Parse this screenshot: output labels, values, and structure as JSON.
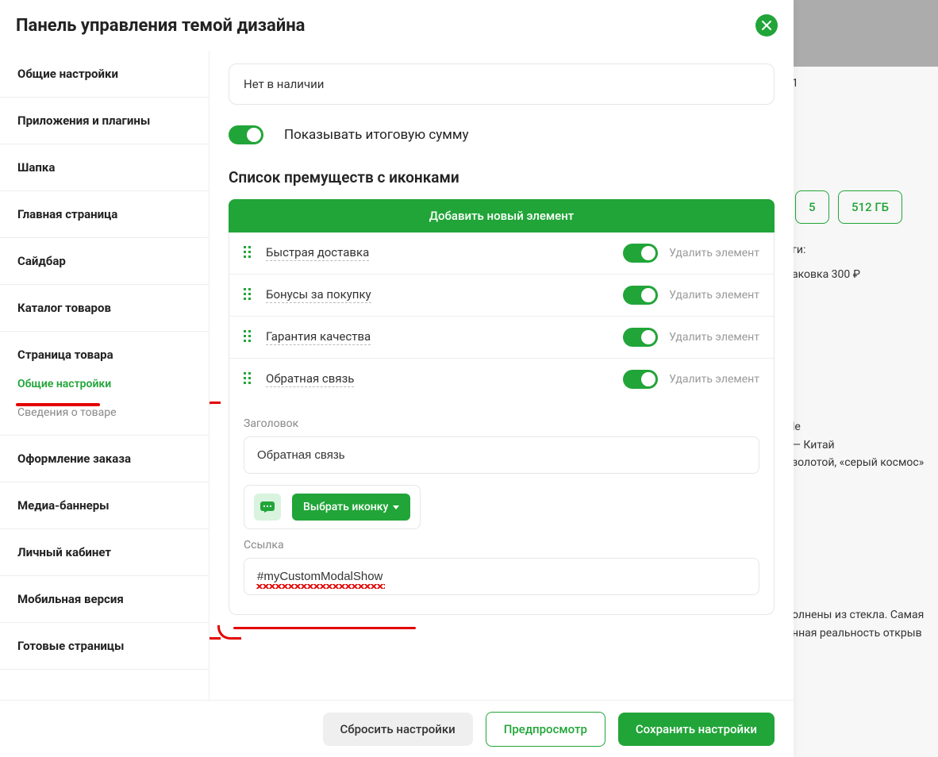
{
  "header": {
    "title": "Панель управления темой дизайна"
  },
  "sidebar": {
    "items": [
      {
        "label": "Общие настройки"
      },
      {
        "label": "Приложения и плагины"
      },
      {
        "label": "Шапка"
      },
      {
        "label": "Главная страница"
      },
      {
        "label": "Сайдбар"
      },
      {
        "label": "Каталог товаров"
      },
      {
        "label": "Страница товара",
        "children": [
          {
            "label": "Общие настройки",
            "active": true
          },
          {
            "label": "Сведения о товаре"
          }
        ]
      },
      {
        "label": "Оформление заказа"
      },
      {
        "label": "Медиа-баннеры"
      },
      {
        "label": "Личный кабинет"
      },
      {
        "label": "Мобильная версия"
      },
      {
        "label": "Готовые страницы"
      }
    ]
  },
  "main": {
    "stock_input_value": "Нет в наличии",
    "show_total_label": "Показывать итоговую сумму",
    "section_title": "Список премуществ с иконками",
    "add_button": "Добавить новый элемент",
    "delete_label": "Удалить элемент",
    "features": [
      {
        "label": "Быстрая доставка"
      },
      {
        "label": "Бонусы за покупку"
      },
      {
        "label": "Гарантия качества"
      },
      {
        "label": "Обратная связь"
      }
    ],
    "expanded": {
      "title_label": "Заголовок",
      "title_value": "Обратная связь",
      "pick_icon_label": "Выбрать иконку",
      "link_label": "Ссылка",
      "link_value": "#myCustomModalShow"
    }
  },
  "footer": {
    "reset": "Сбросить настройки",
    "preview": "Предпросмотр",
    "save": "Сохранить настройки"
  },
  "backdrop": {
    "pill1": "5",
    "pill2": "512 ГБ",
    "line_services": "ги:",
    "line_pack": "аковка 300 ₽",
    "line_brand": "le",
    "line_origin": " — Китай",
    "line_color": "золотой, «серый космос»",
    "line_glass": "олнены из стекла. Самая",
    "line_reality": "нная реальность открыв",
    "num": "1"
  }
}
